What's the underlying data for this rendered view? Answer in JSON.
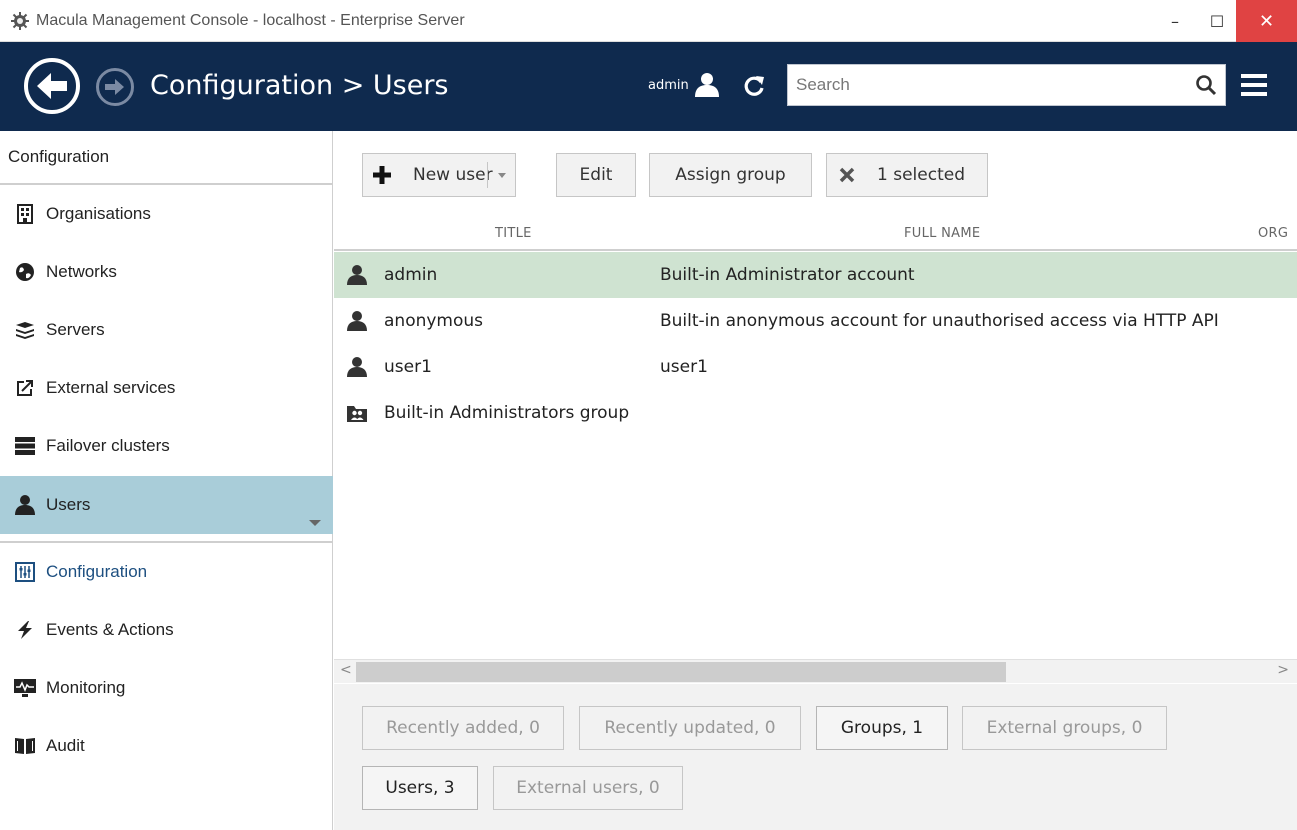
{
  "window": {
    "title": "Macula Management Console - localhost - Enterprise Server",
    "min_glyph": "–",
    "max_glyph": "☐",
    "close_glyph": "✕"
  },
  "header": {
    "breadcrumb": "Configuration > Users",
    "user_name": "admin",
    "search_placeholder": "Search",
    "search_value": ""
  },
  "sidebar": {
    "section_title": "Configuration",
    "items": [
      {
        "label": "Organisations",
        "icon": "building-icon"
      },
      {
        "label": "Networks",
        "icon": "globe-icon"
      },
      {
        "label": "Servers",
        "icon": "servers-stack-icon"
      },
      {
        "label": "External services",
        "icon": "external-link-icon"
      },
      {
        "label": "Failover clusters",
        "icon": "cluster-icon"
      },
      {
        "label": "Users",
        "icon": "user-icon",
        "active": true
      }
    ],
    "sections": [
      {
        "label": "Configuration",
        "icon": "sliders-icon"
      },
      {
        "label": "Events & Actions",
        "icon": "lightning-icon"
      },
      {
        "label": "Monitoring",
        "icon": "monitor-pulse-icon"
      },
      {
        "label": "Audit",
        "icon": "book-icon"
      }
    ]
  },
  "toolbar": {
    "new_user": "New user",
    "edit": "Edit",
    "assign_group": "Assign group",
    "selected": "1 selected"
  },
  "table": {
    "columns": [
      "TITLE",
      "FULL NAME",
      "ORG"
    ],
    "rows": [
      {
        "title": "admin",
        "full_name": "Built-in Administrator account",
        "type": "user",
        "selected": true
      },
      {
        "title": "anonymous",
        "full_name": "Built-in anonymous account for unauthorised access via HTTP API",
        "type": "user"
      },
      {
        "title": "user1",
        "full_name": "user1",
        "type": "user"
      },
      {
        "title": "Built-in Administrators group",
        "full_name": "",
        "type": "group"
      }
    ]
  },
  "scroll": {
    "left_arrow": "<",
    "right_arrow": ">"
  },
  "filters": [
    {
      "label": "Recently added, 0",
      "active": false
    },
    {
      "label": "Recently updated, 0",
      "active": false
    },
    {
      "label": "Groups, 1",
      "active": true
    },
    {
      "label": "External groups, 0",
      "active": false
    },
    {
      "label": "Users, 3",
      "active": true
    },
    {
      "label": "External users, 0",
      "active": false
    }
  ],
  "colors": {
    "header_bg": "#0f2a4e",
    "active_sidebar": "#a9cdd9",
    "selected_row": "#cfe3d1",
    "close_button": "#e04343"
  }
}
